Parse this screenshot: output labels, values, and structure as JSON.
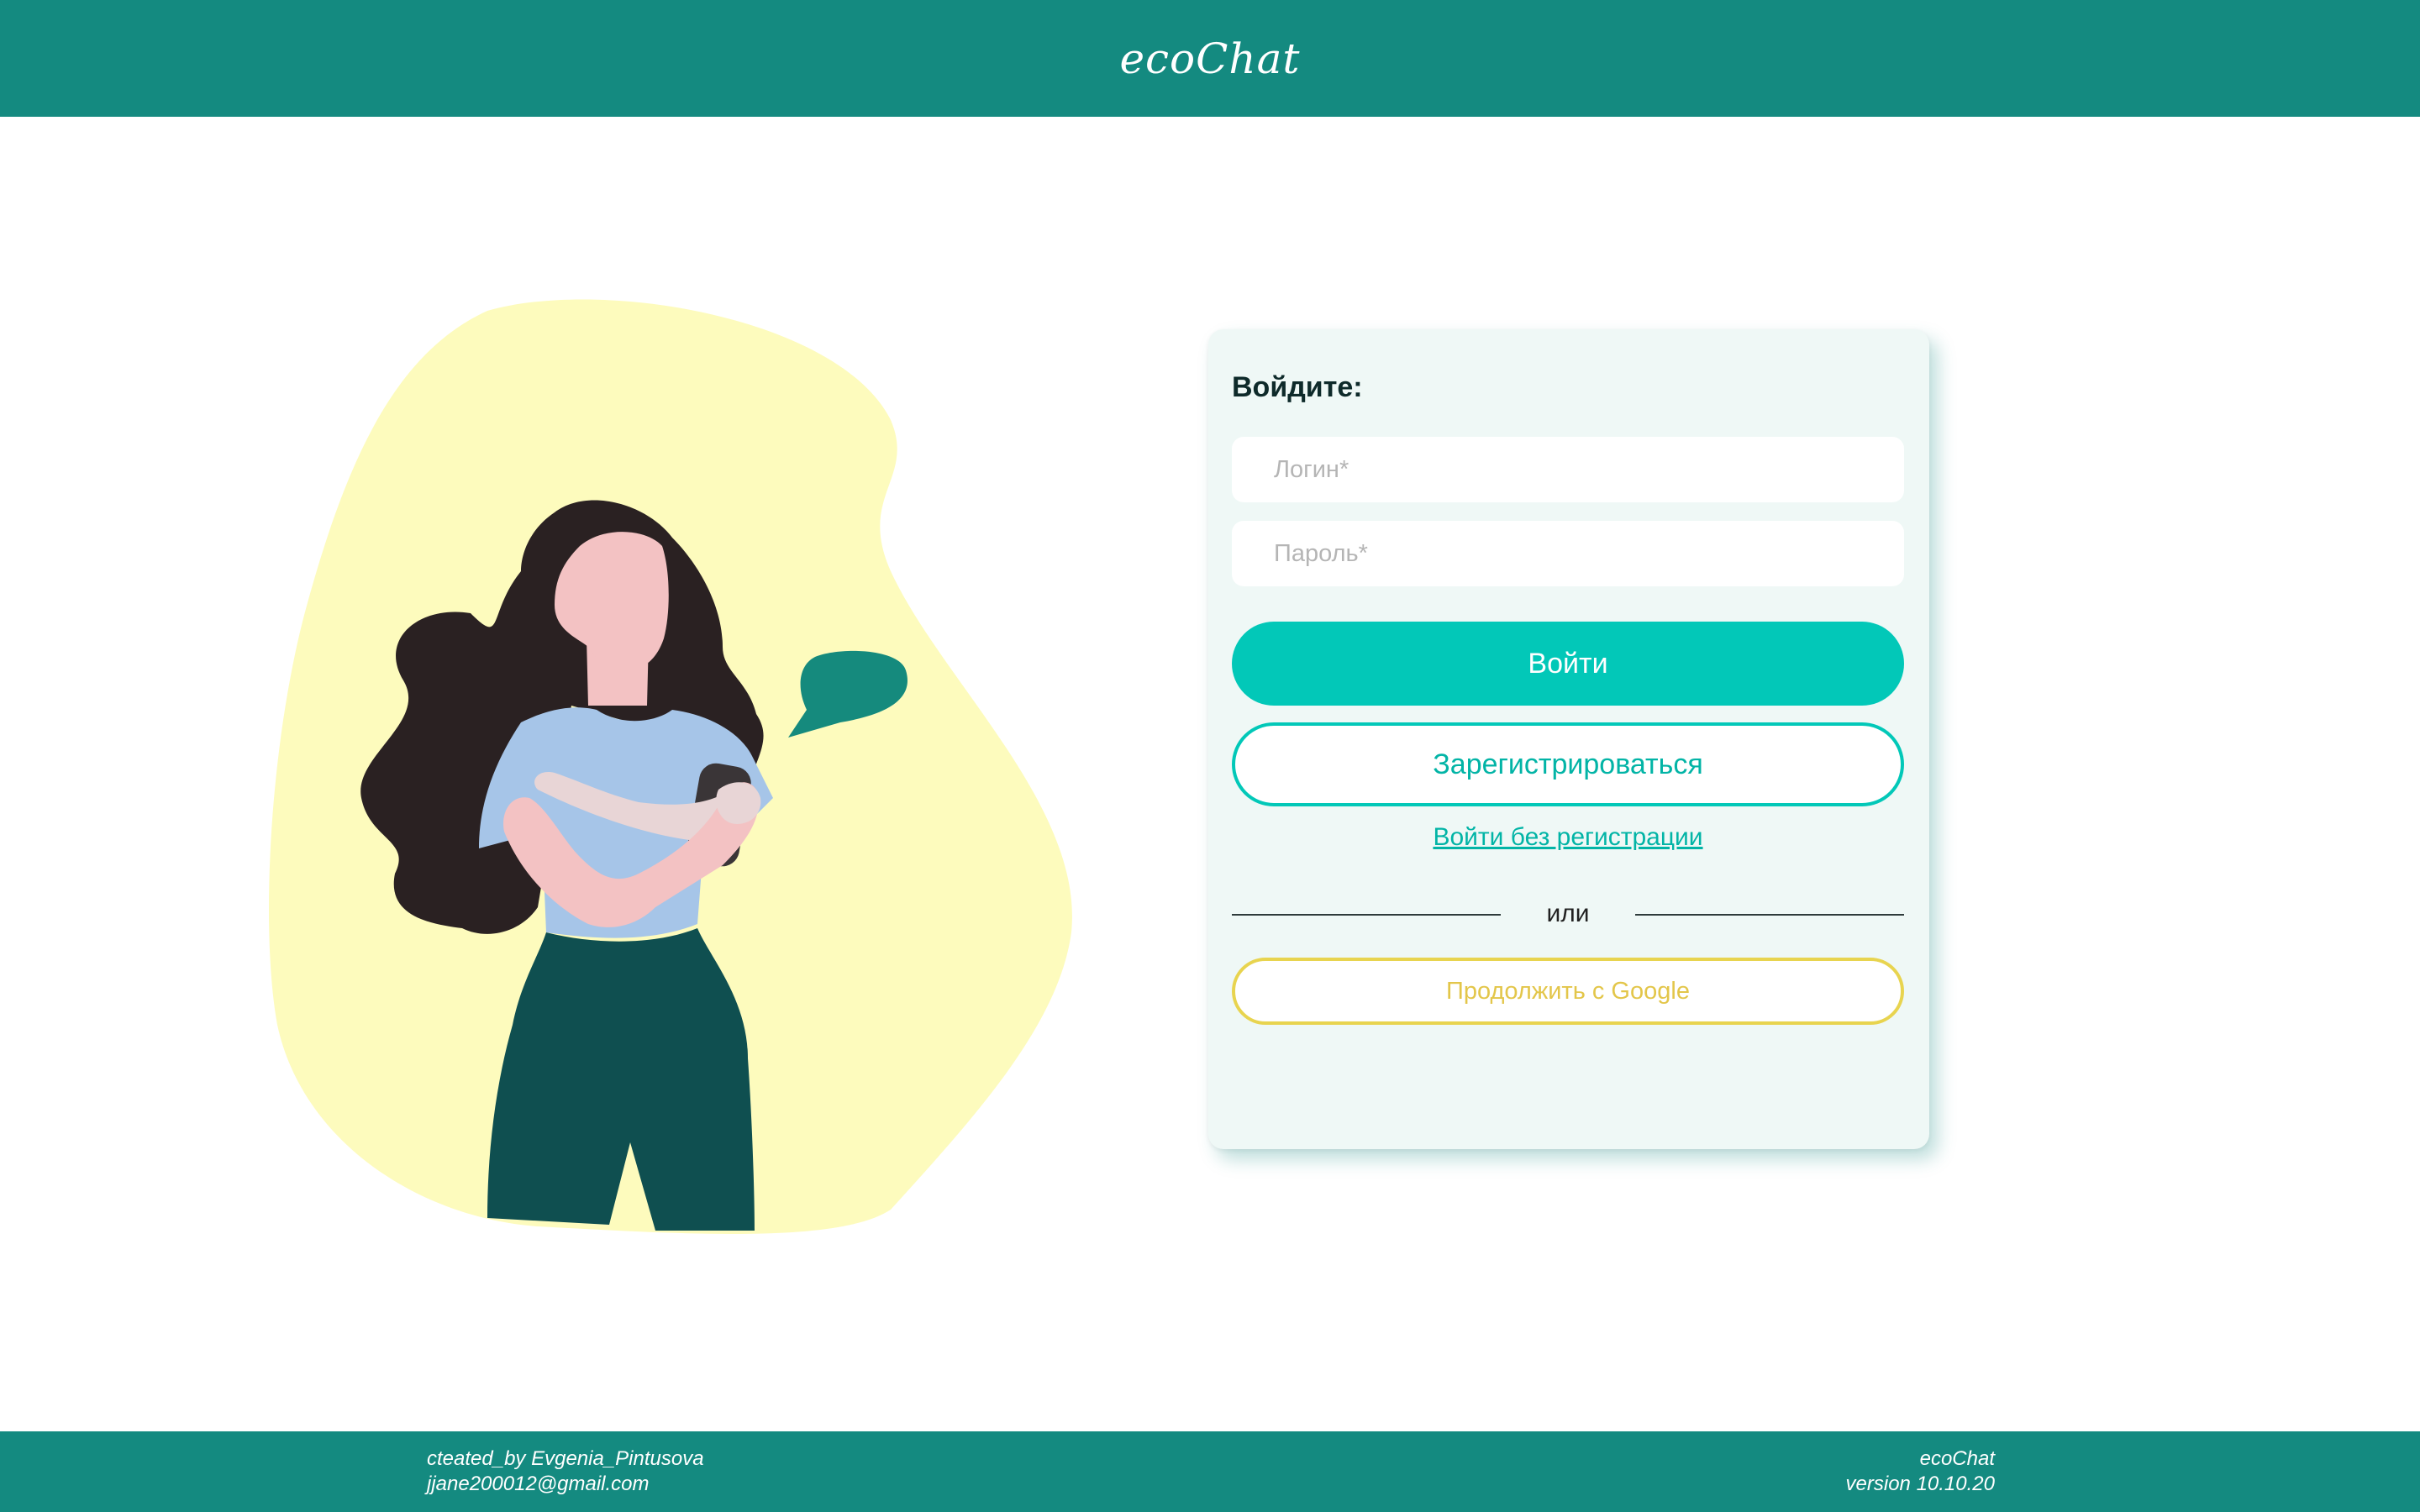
{
  "header": {
    "brand": "ecoChat"
  },
  "login_card": {
    "title": "Войдите:",
    "login_placeholder": "Логин*",
    "password_placeholder": "Пароль*",
    "login_button": "Войти",
    "register_button": "Зарегистрироваться",
    "guest_link": "Войти без регистрации",
    "divider_text": "или",
    "google_button": "Продолжить с Google"
  },
  "footer": {
    "author": "cteated_by Evgenia_Pintusova",
    "email": "jjane200012@gmail.com",
    "app_name": "ecoChat",
    "version": "version 10.10.20"
  },
  "colors": {
    "header_bg": "#148a80",
    "primary": "#02c8b8",
    "google_accent": "#e8d44f",
    "card_bg": "#eff8f6",
    "blob": "#fdfbbd"
  }
}
